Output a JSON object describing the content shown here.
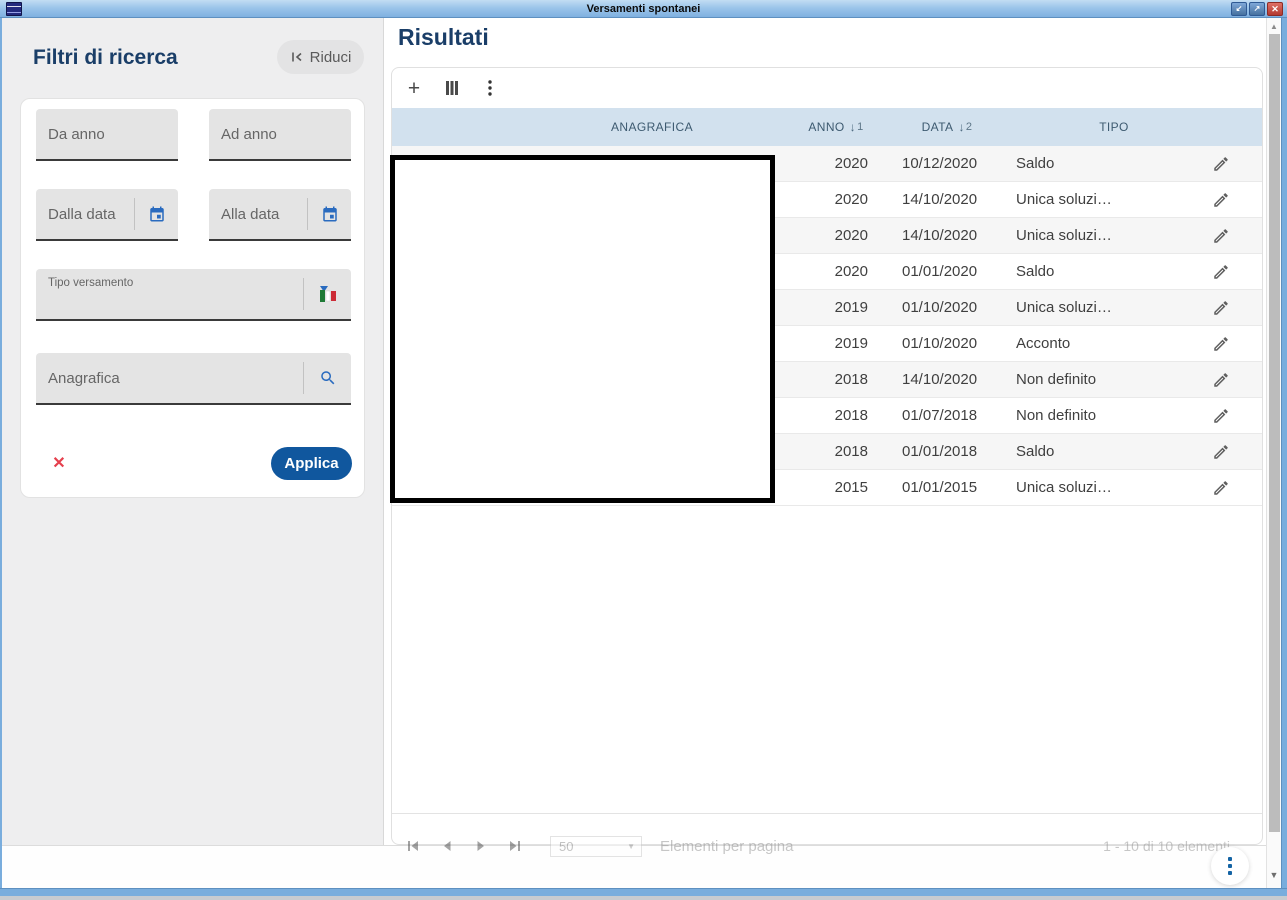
{
  "window": {
    "title": "Versamenti spontanei"
  },
  "sidebar": {
    "title": "Filtri di ricerca",
    "collapse_button": "Riduci",
    "fields": {
      "da_anno_placeholder": "Da anno",
      "ad_anno_placeholder": "Ad anno",
      "dalla_data_placeholder": "Dalla data",
      "alla_data_placeholder": "Alla data",
      "tipo_versamento_label": "Tipo versamento",
      "anagrafica_placeholder": "Anagrafica"
    },
    "apply_button": "Applica"
  },
  "results": {
    "title": "Risultati",
    "table": {
      "headers": {
        "anagrafica": "ANAGRAFICA",
        "anno": "ANNO",
        "data": "DATA",
        "tipo": "TIPO"
      },
      "sort": {
        "anno_order": "1",
        "data_order": "2"
      },
      "rows": [
        {
          "anno": "2020",
          "data": "10/12/2020",
          "tipo": "Saldo"
        },
        {
          "anno": "2020",
          "data": "14/10/2020",
          "tipo": "Unica soluzi…"
        },
        {
          "anno": "2020",
          "data": "14/10/2020",
          "tipo": "Unica soluzi…"
        },
        {
          "anno": "2020",
          "data": "01/01/2020",
          "tipo": "Saldo"
        },
        {
          "anno": "2019",
          "data": "01/10/2020",
          "tipo": "Unica soluzi…"
        },
        {
          "anno": "2019",
          "data": "01/10/2020",
          "tipo": "Acconto"
        },
        {
          "anno": "2018",
          "data": "14/10/2020",
          "tipo": "Non definito"
        },
        {
          "anno": "2018",
          "data": "01/07/2018",
          "tipo": "Non definito"
        },
        {
          "anno": "2018",
          "data": "01/01/2018",
          "tipo": "Saldo"
        },
        {
          "anno": "2015",
          "data": "01/01/2015",
          "tipo": "Unica soluzi…"
        }
      ]
    },
    "pagination": {
      "page_size": "50",
      "items_per_page_label": "Elementi per pagina",
      "range_label": "1 - 10 di 10 elementi"
    }
  },
  "icons": {
    "minimize": "↙",
    "maximize": "↗",
    "close": "✕",
    "clear": "✕",
    "plus": "+",
    "sort_desc": "↓",
    "dropdown": "▼",
    "scroll_up": "▲",
    "scroll_down": "▼"
  },
  "colors": {
    "accent_blue": "#10579e",
    "navy_title": "#1a3e68",
    "table_header_bg": "#d2e1ee",
    "danger_red": "#e5404d",
    "frame_blue": "#79addd"
  }
}
